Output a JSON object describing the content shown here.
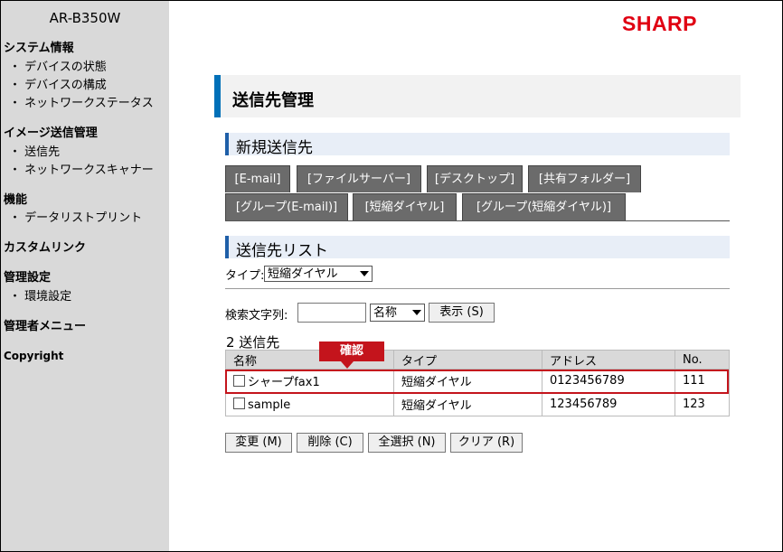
{
  "sidebar": {
    "model": "AR-B350W",
    "sections": [
      {
        "title": "システム情報",
        "items": [
          "・ デバイスの状態",
          "・ デバイスの構成",
          "・ ネットワークステータス"
        ]
      },
      {
        "title": "イメージ送信管理",
        "items": [
          "・ 送信先",
          "・ ネットワークスキャナー"
        ]
      },
      {
        "title": "機能",
        "items": [
          "・ データリストプリント"
        ]
      },
      {
        "title": "カスタムリンク",
        "items": []
      },
      {
        "title": "管理設定",
        "items": [
          "・ 環境設定"
        ]
      },
      {
        "title": "管理者メニュー",
        "items": []
      },
      {
        "title": "Copyright",
        "items": []
      }
    ]
  },
  "brand": {
    "logo": "SHARP",
    "color": "#e00012"
  },
  "page_title": "送信先管理",
  "new_section": {
    "title": "新規送信先",
    "tabs": [
      "[E-mail]",
      "[ファイルサーバー]",
      "[デスクトップ]",
      "[共有フォルダー]",
      "[グループ(E-mail)]",
      "[短縮ダイヤル]",
      "[グループ(短縮ダイヤル)]"
    ]
  },
  "list_section": {
    "title": "送信先リスト",
    "type_label": "タイプ:",
    "type_value": "短縮ダイヤル",
    "search_label": "検索文字列:",
    "search_value": "",
    "search_mode": "名称",
    "show_button": "表示 (S)",
    "count": "2 送信先",
    "callout": "確認",
    "columns": [
      "名称",
      "タイプ",
      "アドレス",
      "No."
    ],
    "rows": [
      {
        "name": "シャープfax1",
        "type": "短縮ダイヤル",
        "address": "0123456789",
        "no": "111"
      },
      {
        "name": "sample",
        "type": "短縮ダイヤル",
        "address": "123456789",
        "no": "123"
      }
    ],
    "buttons": [
      "変更 (M)",
      "削除 (C)",
      "全選択 (N)",
      "クリア (R)"
    ]
  },
  "colors": {
    "accent": "#0070b8",
    "highlight": "#c4141c"
  }
}
